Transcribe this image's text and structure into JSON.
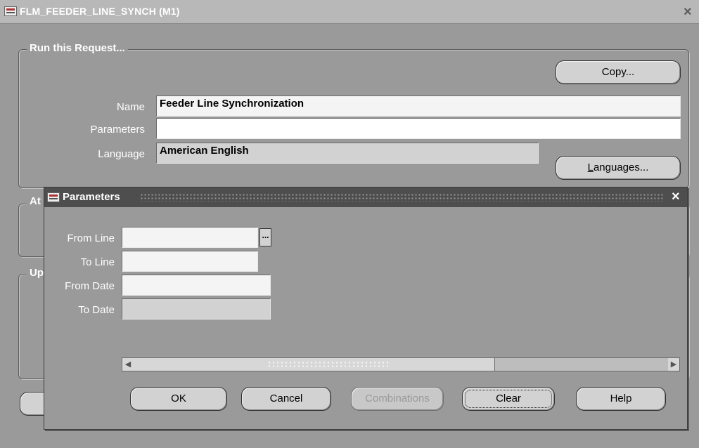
{
  "window": {
    "title": "FLM_FEEDER_LINE_SYNCH (M1)",
    "close_icon": "×"
  },
  "request_frame": {
    "legend": "Run this Request...",
    "copy_button": "Copy...",
    "name_label": "Name",
    "name_value": "Feeder Line Synchronization",
    "parameters_label": "Parameters",
    "parameters_value": "",
    "language_label": "Language",
    "language_value": "American English",
    "languages_button_prefix": "",
    "languages_button_accel": "L",
    "languages_button_rest": "anguages..."
  },
  "hidden_frames": {
    "at_frame_legend": "At",
    "up_frame_legend": "Up"
  },
  "parameters_dialog": {
    "title": "Parameters",
    "close_icon": "×",
    "lov_icon": "...",
    "fields": [
      {
        "label": "From Line",
        "value": ""
      },
      {
        "label": "To Line",
        "value": ""
      },
      {
        "label": "From Date",
        "value": ""
      },
      {
        "label": "To Date",
        "value": ""
      }
    ],
    "scroll_left_icon": "◀",
    "scroll_right_icon": "▶",
    "buttons": {
      "ok": "OK",
      "cancel": "Cancel",
      "combinations": "Combinations",
      "clear": "Clear",
      "help": "Help"
    }
  }
}
